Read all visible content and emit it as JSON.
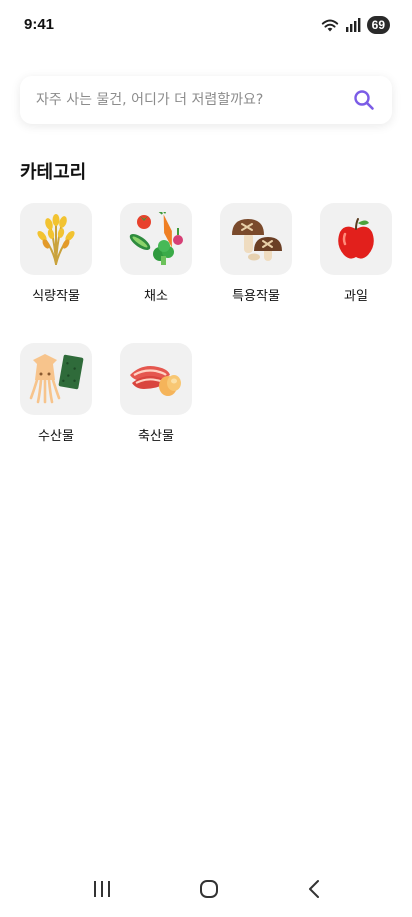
{
  "status_bar": {
    "time": "9:41",
    "battery": "69",
    "icons": [
      "wifi-icon",
      "signal-icon",
      "battery-icon"
    ]
  },
  "search": {
    "placeholder": "자주 사는 물건, 어디가 더 저렴할까요?",
    "icon": "search-icon",
    "accent": "#7b5ce6"
  },
  "category": {
    "title": "카테고리",
    "items": [
      {
        "label": "식량작물",
        "icon": "grain-icon"
      },
      {
        "label": "채소",
        "icon": "vegetable-icon"
      },
      {
        "label": "특용작물",
        "icon": "mushroom-icon"
      },
      {
        "label": "과일",
        "icon": "apple-icon"
      },
      {
        "label": "수산물",
        "icon": "squid-icon"
      },
      {
        "label": "축산물",
        "icon": "meat-icon"
      }
    ]
  },
  "nav": {
    "buttons": [
      "recent-apps-icon",
      "home-icon",
      "back-icon"
    ]
  },
  "colors": {
    "tile_bg": "#f1f1f1",
    "text": "#111111",
    "placeholder": "#8c8c8c"
  }
}
